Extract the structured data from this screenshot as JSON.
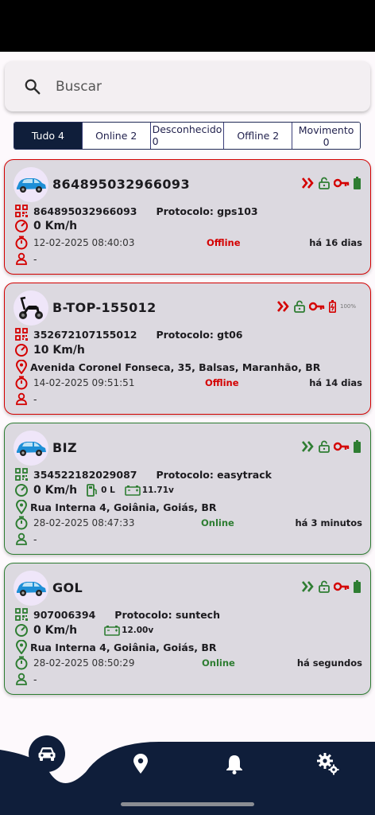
{
  "search": {
    "placeholder": "Buscar"
  },
  "filters": [
    {
      "label": "Tudo 4",
      "active": true
    },
    {
      "label": "Online 2",
      "active": false
    },
    {
      "label": "Desconhecido 0",
      "active": false
    },
    {
      "label": "Offline 2",
      "active": false
    },
    {
      "label": "Movimento 0",
      "active": false
    }
  ],
  "colors": {
    "offline": "#d40000",
    "online": "#2e7d32",
    "navbar": "#0f1e3a"
  },
  "devices": [
    {
      "title": "864895032966093",
      "imei": "864895032966093",
      "protocol": "Protocolo: gps103",
      "speed": "0 Km/h",
      "datetime": "12-02-2025 08:40:03",
      "status": "Offline",
      "ago": "há 16 dias",
      "user": "-",
      "vehicle_icon": "blue-car-image"
    },
    {
      "title": "B-TOP-155012",
      "imei": "352672107155012",
      "protocol": "Protocolo: gt06",
      "speed": "10 Km/h",
      "address": "Avenida Coronel Fonseca, 35, Balsas, Maranhão, BR",
      "datetime": "14-02-2025 09:51:51",
      "status": "Offline",
      "ago": "há 14 dias",
      "user": "-",
      "battery_percent": "100%",
      "vehicle_icon": "scooter-image"
    },
    {
      "title": "BIZ",
      "imei": "354522182029087",
      "protocol": "Protocolo: easytrack",
      "speed": "0 Km/h",
      "fuel": "0 L",
      "voltage": "11.71v",
      "address": "Rua Interna 4, Goiânia, Goiás, BR",
      "datetime": "28-02-2025 08:47:33",
      "status": "Online",
      "ago": "há 3 minutos",
      "user": "-",
      "vehicle_icon": "blue-car-image"
    },
    {
      "title": "GOL",
      "imei": "907006394",
      "protocol": "Protocolo: suntech",
      "speed": "0 Km/h",
      "voltage": "12.00v",
      "address": "Rua Interna 4, Goiânia, Goiás, BR",
      "datetime": "28-02-2025 08:50:29",
      "status": "Online",
      "ago": "há segundos",
      "user": "-",
      "vehicle_icon": "blue-car-image"
    }
  ],
  "navbar": {
    "items": [
      "car-icon",
      "location-pin-icon",
      "bell-icon",
      "settings-gears-icon"
    ]
  }
}
